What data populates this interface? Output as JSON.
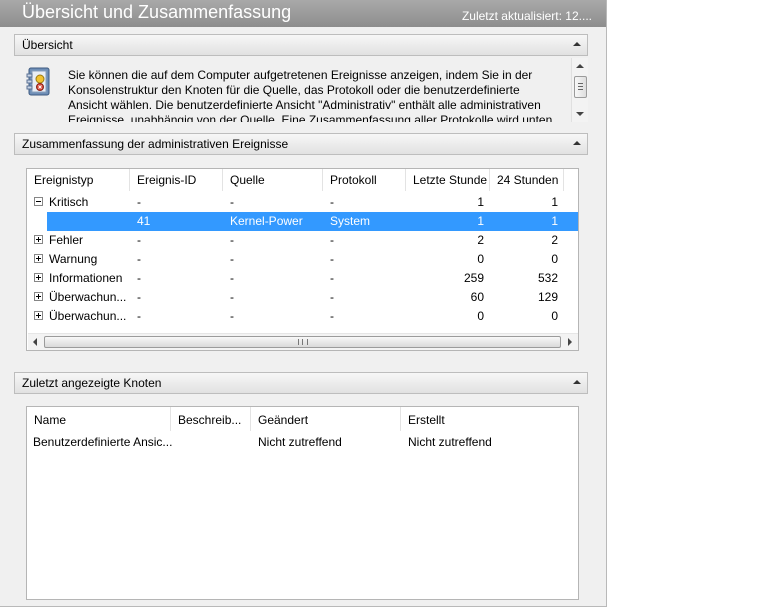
{
  "header": {
    "title": "Übersicht und Zusammenfassung",
    "updated": "Zuletzt aktualisiert: 12...."
  },
  "overview": {
    "heading": "Übersicht",
    "text": "Sie können die auf dem Computer aufgetretenen Ereignisse anzeigen, indem Sie in der Konsolenstruktur den Knoten für die Quelle, das Protokoll oder die benutzerdefinierte Ansicht wählen. Die benutzerdefinierte Ansicht \"Administrativ\" enthält alle administrativen Ereignisse, unabhängig von der Quelle. Eine Zusammenfassung aller Protokolle wird unten angezeigt.",
    "icon": "event-viewer-icon"
  },
  "summary": {
    "heading": "Zusammenfassung der administrativen Ereignisse",
    "columns": [
      "Ereignistyp",
      "Ereignis-ID",
      "Quelle",
      "Protokoll",
      "Letzte Stunde",
      "24 Stunden"
    ],
    "rows": [
      {
        "type": "Kritisch",
        "id": "-",
        "source": "-",
        "log": "-",
        "hour": "1",
        "day": "1",
        "expander": "minus"
      },
      {
        "type": "",
        "id": "41",
        "source": "Kernel-Power",
        "log": "System",
        "hour": "1",
        "day": "1",
        "selected": true
      },
      {
        "type": "Fehler",
        "id": "-",
        "source": "-",
        "log": "-",
        "hour": "2",
        "day": "2",
        "expander": "plus"
      },
      {
        "type": "Warnung",
        "id": "-",
        "source": "-",
        "log": "-",
        "hour": "0",
        "day": "0",
        "expander": "plus"
      },
      {
        "type": "Informationen",
        "id": "-",
        "source": "-",
        "log": "-",
        "hour": "259",
        "day": "532",
        "expander": "plus"
      },
      {
        "type": "Überwachun...",
        "id": "-",
        "source": "-",
        "log": "-",
        "hour": "60",
        "day": "129",
        "expander": "plus"
      },
      {
        "type": "Überwachun...",
        "id": "-",
        "source": "-",
        "log": "-",
        "hour": "0",
        "day": "0",
        "expander": "plus"
      }
    ]
  },
  "recent": {
    "heading": "Zuletzt angezeigte Knoten",
    "columns": [
      "Name",
      "Beschreib...",
      "Geändert",
      "Erstellt"
    ],
    "rows": [
      {
        "name": "Benutzerdefinierte Ansic...",
        "desc": "",
        "modified": "Nicht zutreffend",
        "created": "Nicht zutreffend"
      }
    ]
  },
  "colors": {
    "selection": "#3399ff",
    "topbar": "#9a9a9a"
  }
}
